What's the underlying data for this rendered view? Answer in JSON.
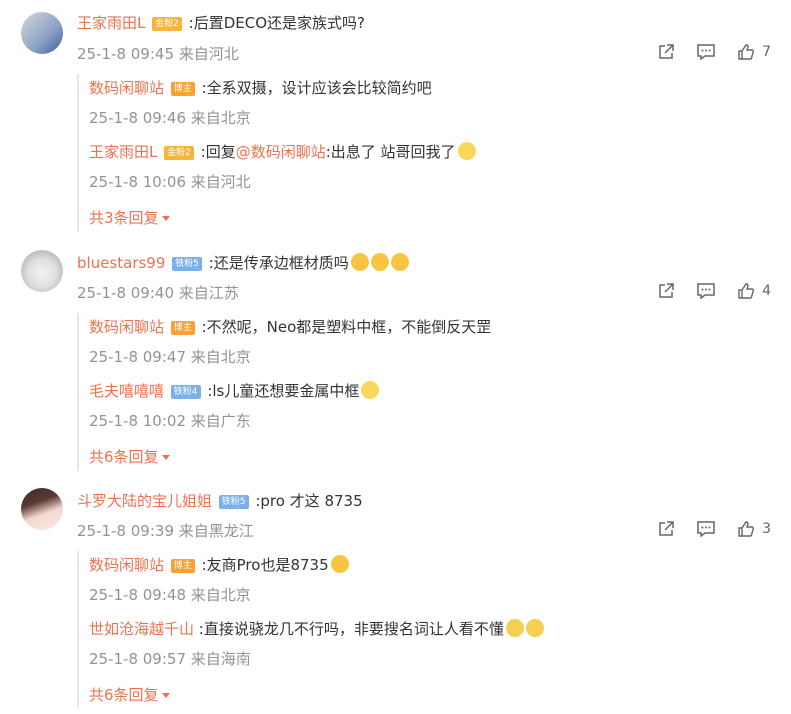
{
  "comments": [
    {
      "user": "王家雨田L",
      "badge": "金粉2",
      "text": ":后置DECO还是家族式吗?",
      "meta": "25-1-8 09:45 来自河北",
      "likes": "7",
      "replies": [
        {
          "user": "数码闲聊站",
          "badge": "博主",
          "text": ":全系双摄，设计应该会比较简约吧",
          "meta": "25-1-8 09:46 来自北京"
        },
        {
          "user": "王家雨田L",
          "badge": "金粉2",
          "prefix": ":回复",
          "mention": "@数码闲聊站",
          "text": ":出息了 站哥回我了",
          "meta": "25-1-8 10:06 来自河北"
        }
      ],
      "more": "共3条回复"
    },
    {
      "user": "bluestars99",
      "badge": "铁粉5",
      "text": ":还是传承边框材质吗",
      "meta": "25-1-8 09:40 来自江苏",
      "likes": "4",
      "replies": [
        {
          "user": "数码闲聊站",
          "badge": "博主",
          "text": ":不然呢，Neo都是塑料中框，不能倒反天罡",
          "meta": "25-1-8 09:47 来自北京"
        },
        {
          "user": "毛夫嘻嘻嘻",
          "badge": "铁粉4",
          "text": ":ls儿童还想要金属中框",
          "meta": "25-1-8 10:02 来自广东"
        }
      ],
      "more": "共6条回复"
    },
    {
      "user": "斗罗大陆的宝儿姐姐",
      "badge": "铁粉5",
      "text": ":pro 才这 8735",
      "meta": "25-1-8 09:39 来自黑龙江",
      "likes": "3",
      "replies": [
        {
          "user": "数码闲聊站",
          "badge": "博主",
          "text": ":友商Pro也是8735",
          "meta": "25-1-8 09:48 来自北京"
        },
        {
          "user": "世如沧海越千山",
          "badge": "",
          "text": ":直接说骁龙几不行吗，非要搜名词让人看不懂",
          "meta": "25-1-8 09:57 来自海南"
        }
      ],
      "more": "共6条回复"
    }
  ],
  "icons": {
    "share": "share-icon",
    "comment": "comment-icon",
    "like": "like-icon"
  },
  "colors": {
    "username": "#eb7350",
    "meta": "#939393",
    "gold_badge": "#f8b43b",
    "iron_badge": "#7bb1e8",
    "blogger_badge": "#f6a236"
  }
}
